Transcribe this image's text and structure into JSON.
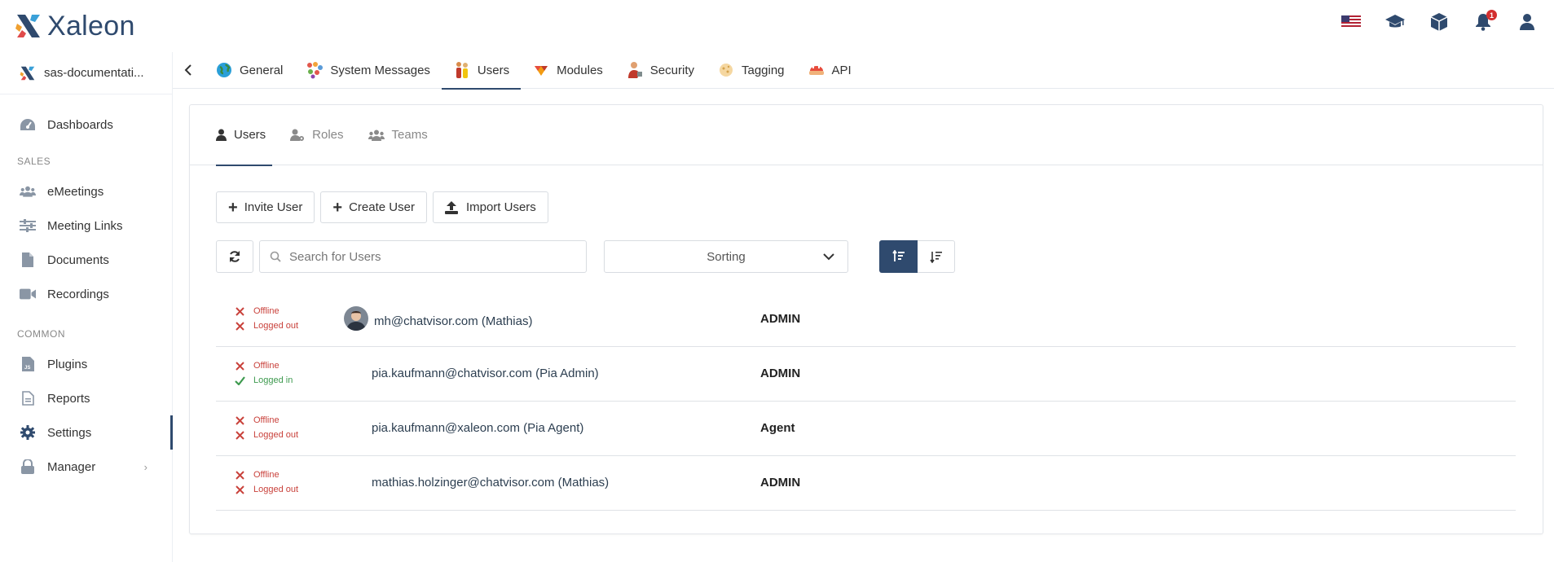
{
  "brand": {
    "name": "Xaleon"
  },
  "header": {
    "icons": [
      "us-flag-icon",
      "graduation-cap-icon",
      "cube-icon",
      "bell-icon",
      "user-icon"
    ],
    "notification_count": "1"
  },
  "sidebar": {
    "project": "sas-documentati...",
    "dashboards": "Dashboards",
    "sections": {
      "sales": "SALES",
      "common": "COMMON"
    },
    "sales_items": [
      {
        "label": "eMeetings",
        "icon": "users-group-icon"
      },
      {
        "label": "Meeting Links",
        "icon": "sliders-icon"
      },
      {
        "label": "Documents",
        "icon": "document-icon"
      },
      {
        "label": "Recordings",
        "icon": "video-camera-icon"
      }
    ],
    "common_items": [
      {
        "label": "Plugins",
        "icon": "js-file-icon"
      },
      {
        "label": "Reports",
        "icon": "report-file-icon"
      },
      {
        "label": "Settings",
        "icon": "gear-icon"
      },
      {
        "label": "Manager",
        "icon": "lock-icon"
      }
    ]
  },
  "main_tabs": [
    {
      "label": "General",
      "icon": "globe-icon"
    },
    {
      "label": "System Messages",
      "icon": "messages-icon"
    },
    {
      "label": "Users",
      "icon": "users-icon"
    },
    {
      "label": "Modules",
      "icon": "modules-icon"
    },
    {
      "label": "Security",
      "icon": "security-icon"
    },
    {
      "label": "Tagging",
      "icon": "tag-icon"
    },
    {
      "label": "API",
      "icon": "api-icon"
    }
  ],
  "sub_tabs": [
    {
      "label": "Users"
    },
    {
      "label": "Roles"
    },
    {
      "label": "Teams"
    }
  ],
  "actions": {
    "invite": "Invite User",
    "create": "Create User",
    "import": "Import Users"
  },
  "filters": {
    "search_placeholder": "Search for Users",
    "sorting": "Sorting"
  },
  "users": [
    {
      "status1": "Offline",
      "status2": "Logged out",
      "name": "mh@chatvisor.com (Mathias)",
      "role": "ADMIN",
      "has_avatar": true
    },
    {
      "status1": "Offline",
      "status2": "Logged in",
      "name": "pia.kaufmann@chatvisor.com (Pia Admin)",
      "role": "ADMIN",
      "has_avatar": false
    },
    {
      "status1": "Offline",
      "status2": "Logged out",
      "name": "pia.kaufmann@xaleon.com (Pia Agent)",
      "role": "Agent",
      "has_avatar": false
    },
    {
      "status1": "Offline",
      "status2": "Logged out",
      "name": "mathias.holzinger@chatvisor.com (Mathias)",
      "role": "ADMIN",
      "has_avatar": false
    }
  ],
  "colors": {
    "brand": "#2f4a6e",
    "offline": "#c9423c",
    "logged_in": "#3e9a4f"
  }
}
